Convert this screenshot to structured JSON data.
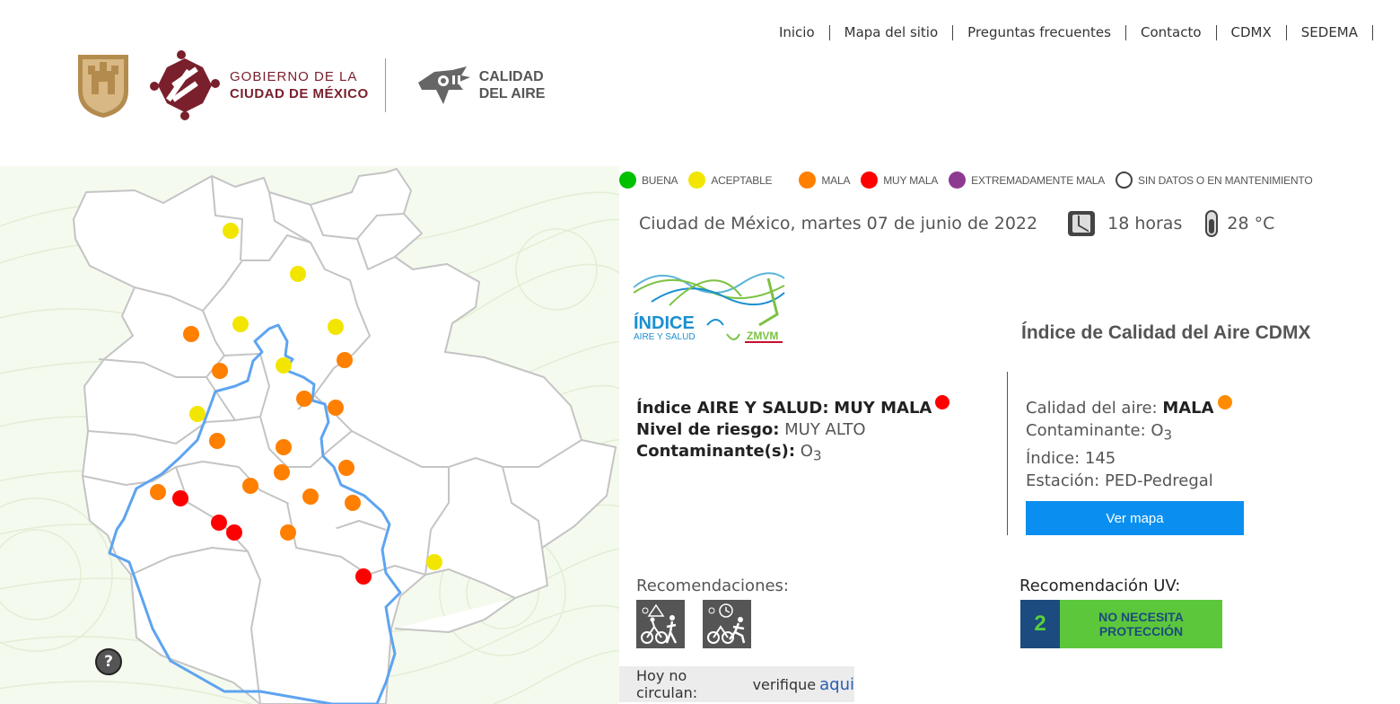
{
  "nav": {
    "items": [
      "Inicio",
      "Mapa del sitio",
      "Preguntas frecuentes",
      "Contacto",
      "CDMX",
      "SEDEMA"
    ]
  },
  "header": {
    "gov_line1": "GOBIERNO DE LA",
    "gov_line2": "CIUDAD DE MÉXICO",
    "calidad_line1": "CALIDAD",
    "calidad_line2": "DEL AIRE",
    "brand_color": "#7a1f2c"
  },
  "legend": [
    {
      "label": "BUENA",
      "color": "#00c000"
    },
    {
      "label": "ACEPTABLE",
      "color": "#f2e600"
    },
    {
      "label": "MALA",
      "color": "#ff7f00"
    },
    {
      "label": "MUY MALA",
      "color": "#ff0000"
    },
    {
      "label": "EXTREMADAMENTE MALA",
      "color": "#8e3a91"
    },
    {
      "label": "SIN DATOS O EN MANTENIMIENTO",
      "color": "#ffffff"
    }
  ],
  "status": {
    "date": "Ciudad de México, martes 07 de junio de 2022",
    "hour": "18 horas",
    "temperature": "28 °C"
  },
  "logo": {
    "indice_big": "ÍNDICE",
    "indice_small": "AIRE Y SALUD",
    "zmvm": "ZMVM"
  },
  "panel_title": "Índice de Calidad del Aire CDMX",
  "aire_salud": {
    "label": "Índice AIRE Y SALUD:",
    "value": "MUY MALA",
    "riesgo_label": "Nivel de riesgo:",
    "riesgo_value": "MUY ALTO",
    "contaminante_label": "Contaminante(s):",
    "contaminante_value": "O",
    "contaminante_sub": "3"
  },
  "calidad": {
    "label": "Calidad del aire:",
    "value": "MALA",
    "contaminante_label": "Contaminante: O",
    "contaminante_sub": "3",
    "indice": "Índice: 145",
    "estacion": "Estación: PED-Pedregal",
    "button": "Ver mapa"
  },
  "recomendaciones": {
    "label": "Recomendaciones:",
    "icons": [
      "cyclist-warning-icon",
      "cyclist-runner-clock-icon"
    ]
  },
  "uv": {
    "label": "Recomendación UV:",
    "index": "2",
    "text": "NO NECESITA PROTECCIÓN"
  },
  "hoy_no_circula": {
    "label": "Hoy no circulan:",
    "verify": "verifique",
    "link": "aqui"
  },
  "help": "?",
  "stations": [
    {
      "level": "ACEPTABLE"
    },
    {
      "level": "ACEPTABLE"
    },
    {
      "level": "ACEPTABLE"
    },
    {
      "level": "ACEPTABLE"
    },
    {
      "level": "ACEPTABLE"
    },
    {
      "level": "ACEPTABLE"
    },
    {
      "level": "ACEPTABLE"
    },
    {
      "level": "MALA"
    },
    {
      "level": "MALA"
    },
    {
      "level": "MALA"
    },
    {
      "level": "MALA"
    },
    {
      "level": "MALA"
    },
    {
      "level": "MALA"
    },
    {
      "level": "MALA"
    },
    {
      "level": "MALA"
    },
    {
      "level": "MALA"
    },
    {
      "level": "MALA"
    },
    {
      "level": "MALA"
    },
    {
      "level": "MALA"
    },
    {
      "level": "MALA"
    },
    {
      "level": "MALA"
    },
    {
      "level": "MUY MALA"
    },
    {
      "level": "MUY MALA"
    },
    {
      "level": "MUY MALA"
    },
    {
      "level": "MUY MALA"
    }
  ]
}
